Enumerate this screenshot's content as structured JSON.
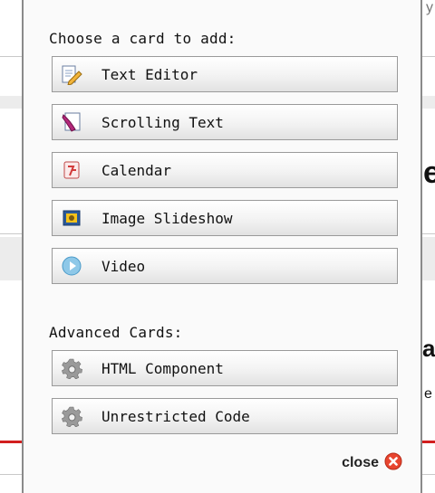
{
  "background": {
    "fragment_top": "y",
    "fragment_e": "e",
    "fragment_a": "a",
    "fragment_e_small": "e"
  },
  "panel": {
    "heading": "Choose a card to add:",
    "cards": [
      {
        "label": "Text Editor",
        "icon": "text-editor-icon"
      },
      {
        "label": "Scrolling Text",
        "icon": "scrolling-text-icon"
      },
      {
        "label": "Calendar",
        "icon": "calendar-icon"
      },
      {
        "label": "Image Slideshow",
        "icon": "image-slideshow-icon"
      },
      {
        "label": "Video",
        "icon": "video-icon"
      }
    ],
    "advanced_heading": "Advanced Cards:",
    "advanced_cards": [
      {
        "label": "HTML Component",
        "icon": "gear-icon"
      },
      {
        "label": "Unrestricted Code",
        "icon": "gear-icon"
      }
    ],
    "close_label": "close"
  },
  "colors": {
    "close_icon": "#e8452f",
    "accent_red": "#d21e1e"
  }
}
